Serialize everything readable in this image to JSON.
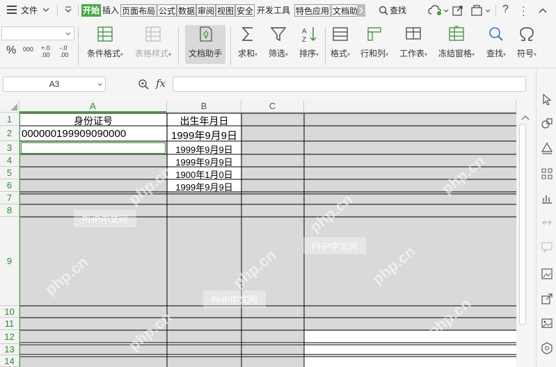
{
  "menubar": {
    "file_label": "文件",
    "tabs": [
      "开始",
      "插入",
      "页面布局",
      "公式",
      "数据",
      "审阅",
      "视图",
      "安全",
      "开发工具",
      "特色应用",
      "文档助"
    ],
    "search_label": "查找"
  },
  "toolbar": {
    "format_left": [
      "%",
      "000",
      "+.0\n.00",
      "-.0\n.00"
    ],
    "items": [
      {
        "label": "条件格式"
      },
      {
        "label": "表格样式"
      },
      {
        "label": "文档助手"
      },
      {
        "label": "求和"
      },
      {
        "label": "筛选"
      },
      {
        "label": "排序"
      },
      {
        "label": "格式"
      },
      {
        "label": "行和列"
      },
      {
        "label": "工作表"
      },
      {
        "label": "冻结窗格"
      },
      {
        "label": "查找"
      },
      {
        "label": "符号"
      }
    ]
  },
  "formula": {
    "cell_ref": "A3",
    "fx": "fx",
    "value": ""
  },
  "sheet": {
    "columns": [
      "A",
      "B",
      "C"
    ],
    "rows": [
      "1",
      "2",
      "3",
      "4",
      "5",
      "6",
      "7",
      "8",
      "9",
      "10",
      "11",
      "12",
      "13",
      "14"
    ],
    "cells": {
      "A1": "身份证号",
      "B1": "出生年月日",
      "A2": "000000199909090000",
      "B2": "1999年9月9日",
      "B3": "1999年9月9日",
      "B4": "1999年9月9日",
      "B5": "1900年1月0日",
      "B6": "1999年9月9日"
    }
  },
  "watermark": {
    "text": "PHP中文网",
    "diag": "php.cn"
  },
  "colors": {
    "accent": "#4aa84a",
    "grey_fill": "#d9d9d9",
    "header_green": "#2e8b2e"
  }
}
